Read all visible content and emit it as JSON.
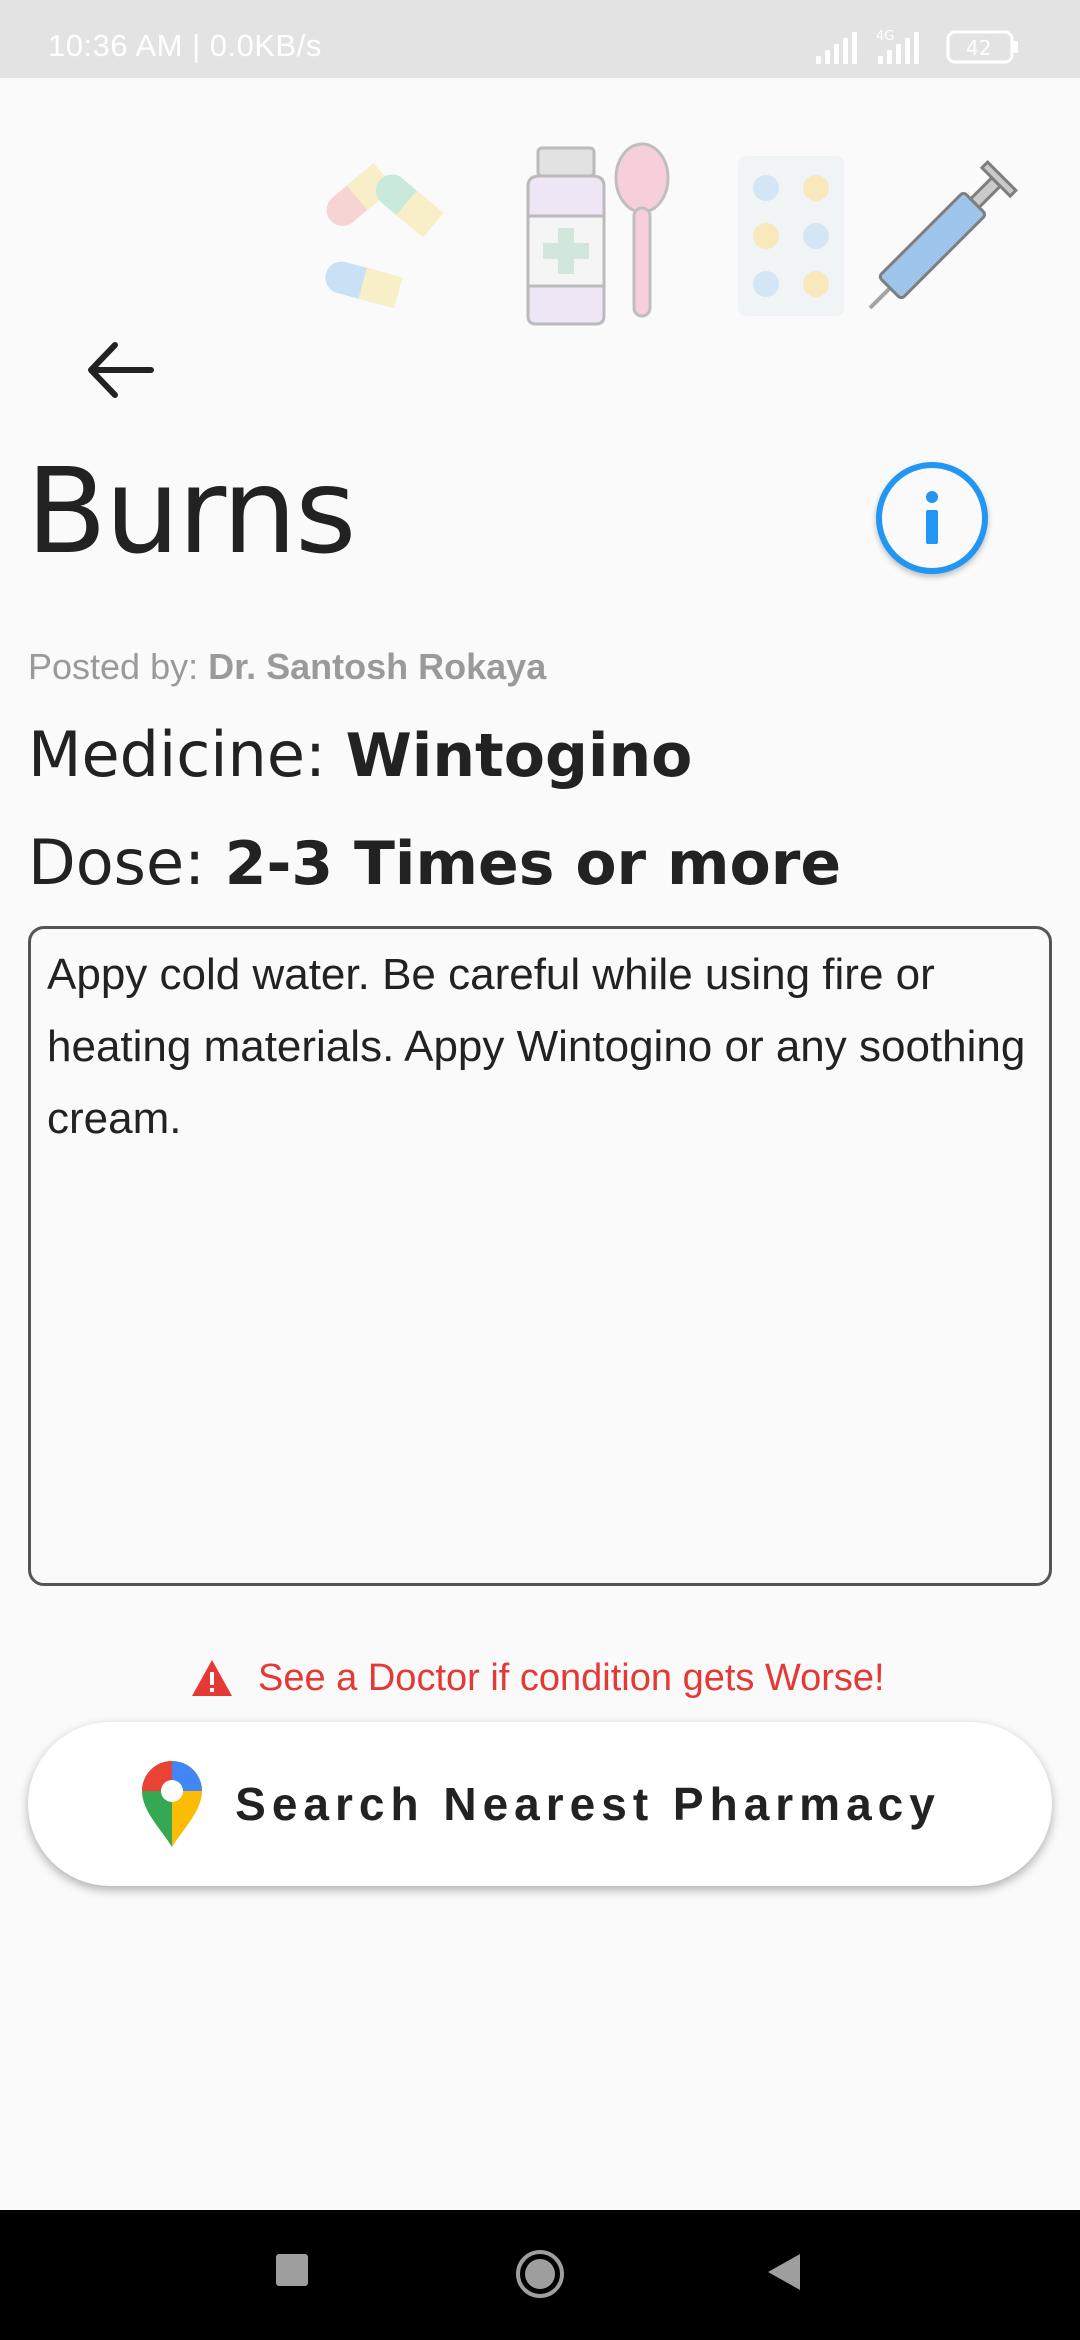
{
  "status_bar": {
    "time": "10:36 AM | 0.0KB/s",
    "network": "4G",
    "battery": "42"
  },
  "header": {
    "back_icon": "arrow-left-icon",
    "title": "Burns",
    "info_icon": "info-icon"
  },
  "details": {
    "posted_by_label": "Posted by: ",
    "posted_by_name": "Dr. Santosh Rokaya",
    "medicine_label": "Medicine: ",
    "medicine_value": "Wintogino",
    "dose_label": "Dose: ",
    "dose_value": "2-3 Times or more",
    "description": "Appy cold water. Be careful while using fire or heating materials. Appy Wintogino or any soothing cream."
  },
  "warning": {
    "icon": "warning-triangle-icon",
    "text": "See a Doctor if condition gets Worse!",
    "color": "#e53935"
  },
  "actions": {
    "pharmacy_button_label": "Search Nearest Pharmacy",
    "pharmacy_icon": "maps-pin-icon"
  },
  "colors": {
    "accent": "#2196f3",
    "background": "#fafafa"
  }
}
